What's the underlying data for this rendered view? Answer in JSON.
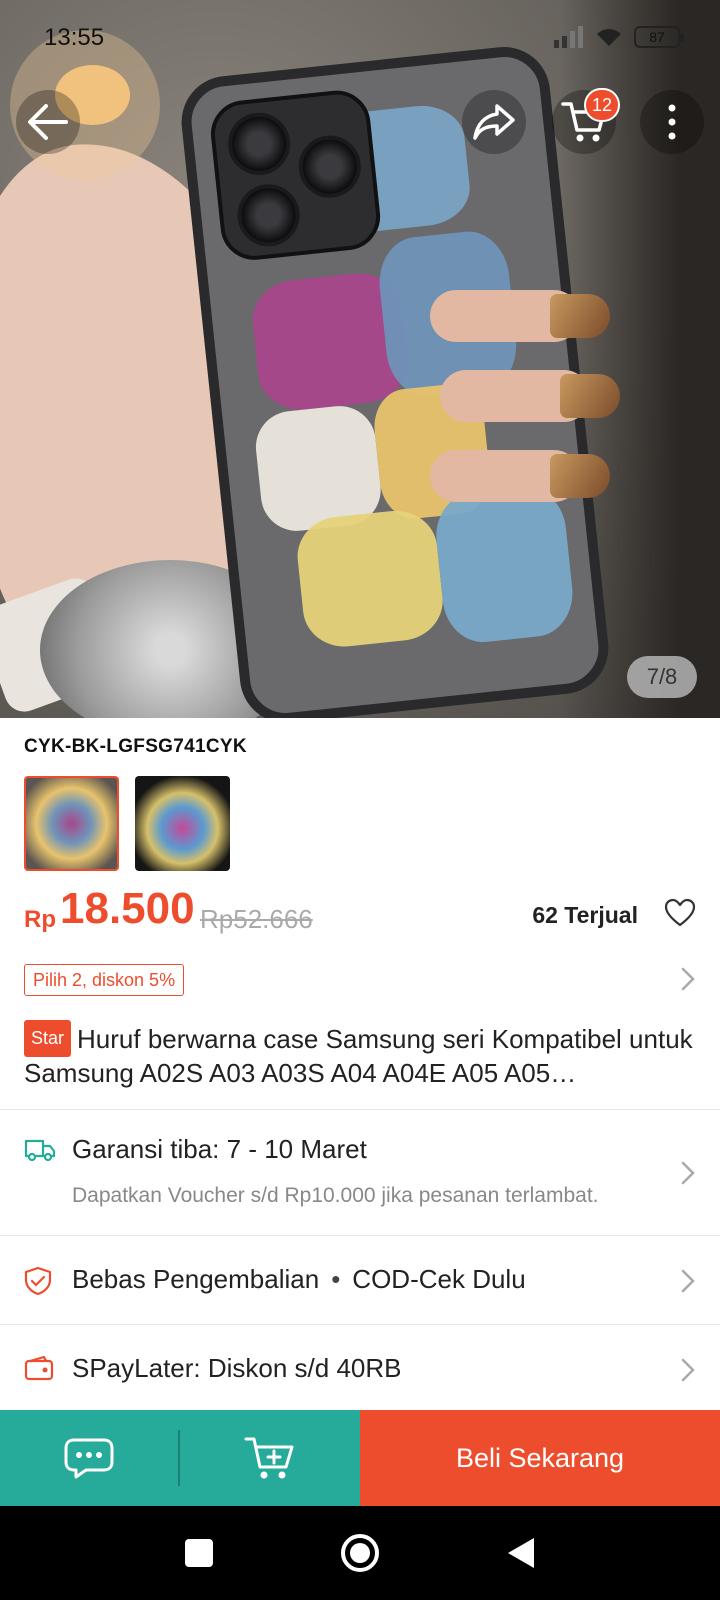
{
  "status_bar": {
    "time": "13:55",
    "battery": "87"
  },
  "nav": {
    "cart_count": "12",
    "icons": [
      "back-arrow-icon",
      "share-icon",
      "cart-icon",
      "more-vertical-icon"
    ]
  },
  "gallery": {
    "counter": "7/8"
  },
  "product": {
    "variant_code": "CYK-BK-LGFSG741CYK",
    "currency": "Rp",
    "price": "18.500",
    "original_price": "Rp52.666",
    "sold": "62 Terjual",
    "promo": "Pilih 2, diskon 5%",
    "badge": "Star",
    "title": "Huruf berwarna case Samsung seri Kompatibel untuk Samsung A02S A03 A03S A04 A04E A05 A05…"
  },
  "shipping": {
    "title": "Garansi tiba: 7 - 10 Maret",
    "subtitle": "Dapatkan Voucher s/d Rp10.000 jika pesanan terlambat."
  },
  "returns": {
    "label_1": "Bebas Pengembalian",
    "label_2": "COD-Cek Dulu"
  },
  "paylater": {
    "label": "SPayLater: Diskon s/d 40RB"
  },
  "bottom_bar": {
    "buy_label": "Beli Sekarang"
  },
  "colors": {
    "accent": "#ee4d2d",
    "teal": "#26aa99"
  }
}
